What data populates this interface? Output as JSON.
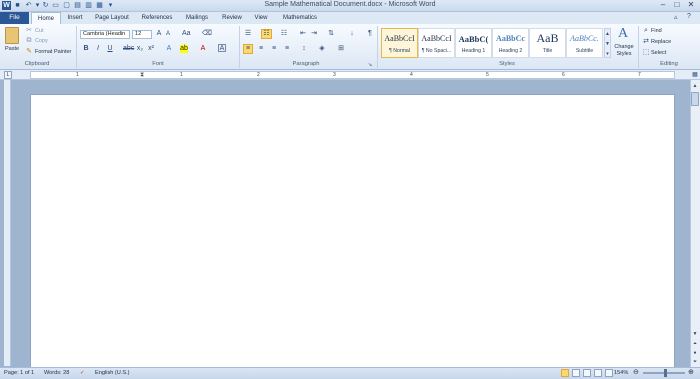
{
  "window": {
    "title": "Sample Mathematical Document.docx - Microsoft Word"
  },
  "tabs": [
    "File",
    "Home",
    "Insert",
    "Page Layout",
    "References",
    "Mailings",
    "Review",
    "View",
    "Mathematics"
  ],
  "clipboard": {
    "paste_label": "Paste",
    "cut_label": "Cut",
    "copy_label": "Copy",
    "format_painter_label": "Format Painter",
    "group_label": "Clipboard"
  },
  "font": {
    "name": "Cambria (Headin",
    "size": "12",
    "group_label": "Font",
    "bold": "B",
    "italic": "I",
    "underline": "U"
  },
  "paragraph": {
    "group_label": "Paragraph"
  },
  "styles": {
    "group_label": "Styles",
    "items": [
      {
        "preview": "AaBbCcI",
        "name": "¶ Normal"
      },
      {
        "preview": "AaBbCcI",
        "name": "¶ No Spaci..."
      },
      {
        "preview": "AaBbC(",
        "name": "Heading 1"
      },
      {
        "preview": "AaBbCc",
        "name": "Heading 2"
      },
      {
        "preview": "AaB",
        "name": "Title"
      },
      {
        "preview": "AaBbCc.",
        "name": "Subtitle"
      }
    ],
    "change_styles_label": "Change Styles"
  },
  "editing": {
    "group_label": "Editing",
    "find_label": "Find",
    "replace_label": "Replace",
    "select_label": "Select"
  },
  "ruler_numbers": [
    "1",
    "1",
    "2",
    "3",
    "4",
    "5",
    "6",
    "7"
  ],
  "status": {
    "page": "Page: 1 of 1",
    "words": "Words: 28",
    "language": "English (U.S.)",
    "zoom": "154%"
  }
}
